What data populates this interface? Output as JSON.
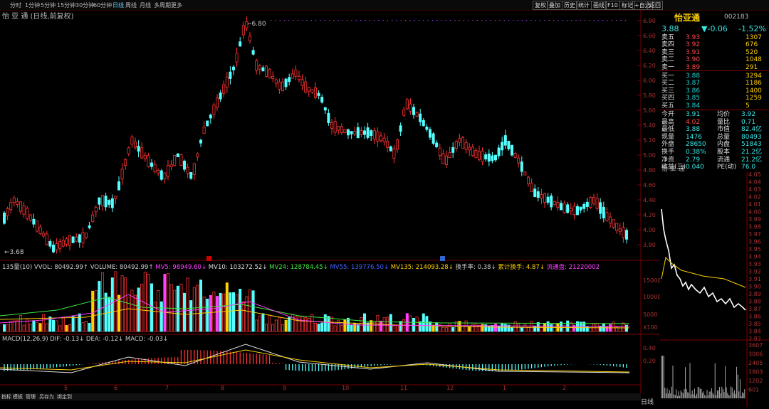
{
  "toolbar": {
    "periods": [
      "分时",
      "1分钟",
      "5分钟",
      "15分钟",
      "30分钟",
      "60分钟",
      "日线",
      "周线",
      "月线",
      "多周期",
      "更多"
    ],
    "active_period": "日线",
    "right_buttons": [
      "复权",
      "叠加",
      "历史",
      "统计",
      "画线",
      "F10",
      "标记",
      "+自选",
      "返回"
    ]
  },
  "stock": {
    "name": "怡亚通",
    "title": "怡 亚 通 (日线,前复权)",
    "code": "002183",
    "price": "3.88",
    "change": "-0.06",
    "change_pct": "-1.52%"
  },
  "main_chart": {
    "high_label": "6.80",
    "low_label": "3.68",
    "y_ticks": [
      "6.80",
      "6.60",
      "6.40",
      "6.20",
      "6.00",
      "5.80",
      "5.60",
      "5.40",
      "5.20",
      "5.00",
      "4.80",
      "4.60",
      "4.40",
      "4.20",
      "4.00",
      "3.80"
    ]
  },
  "volume": {
    "caption": "135量(10) VVOL: 80492.99↑ VOLUME: 80492.99↑ MV5: 98949.60↓ MV10: 103272.52↓ MV24: 128784.45↓ MV55: 139776.50↓ MV135: 214093.28↓ 换手率: 0.38↓ 累计换手: 4.87↓ 流通盘: 21220002",
    "y_ticks": [
      "15000",
      "10000",
      "5000",
      "X100"
    ]
  },
  "macd": {
    "caption": "MACD(12,26,9) DIF: -0.13↓ DEA: -0.12↓ MACD: -0.03↓",
    "y_ticks": [
      "0.40",
      "0.20"
    ]
  },
  "x_months": [
    "",
    "5",
    "6",
    "7",
    "8",
    "9",
    "10",
    "11",
    "12",
    "1",
    "2"
  ],
  "order_book": {
    "sell": [
      [
        "卖五",
        "3.93",
        "1307"
      ],
      [
        "卖四",
        "3.92",
        "676"
      ],
      [
        "卖三",
        "3.91",
        "520"
      ],
      [
        "卖二",
        "3.90",
        "1048"
      ],
      [
        "卖一",
        "3.89",
        "291"
      ]
    ],
    "buy": [
      [
        "买一",
        "3.88",
        "3294"
      ],
      [
        "买二",
        "3.87",
        "1186"
      ],
      [
        "买三",
        "3.86",
        "1400"
      ],
      [
        "买四",
        "3.85",
        "1259"
      ],
      [
        "买五",
        "3.84",
        "5"
      ]
    ]
  },
  "stats": [
    [
      "今开",
      "3.91",
      "均价",
      "3.92"
    ],
    [
      "最高",
      "4.02",
      "量比",
      "0.71"
    ],
    [
      "最低",
      "3.88",
      "市值",
      "82.4亿"
    ],
    [
      "现量",
      "1476",
      "总量",
      "80493"
    ],
    [
      "外盘",
      "28650",
      "内盘",
      "51843"
    ],
    [
      "换手",
      "0.38%",
      "股本",
      "21.2亿"
    ],
    [
      "净资",
      "2.79",
      "流通",
      "21.2亿"
    ],
    [
      "收益(三)",
      "0.040",
      "PE(动)",
      "76.0"
    ]
  ],
  "mini": {
    "label": "怡 亚 通",
    "price_ticks": [
      "4.05",
      "4.04",
      "4.03",
      "4.02",
      "4.01",
      "4.00",
      "3.99",
      "3.98",
      "3.97",
      "3.96",
      "3.95",
      "3.94",
      "3.93",
      "3.92",
      "3.91",
      "3.90",
      "3.89",
      "3.88",
      "3.87",
      "3.86",
      "3.85",
      "3.84",
      "3.83"
    ],
    "vol_ticks": [
      "3607",
      "3006",
      "2405",
      "1803",
      "1202",
      "601"
    ],
    "period_label": "日线"
  },
  "bottom_tabs": [
    "指标",
    "模板",
    "管理",
    "另存为",
    "绑定到"
  ]
}
